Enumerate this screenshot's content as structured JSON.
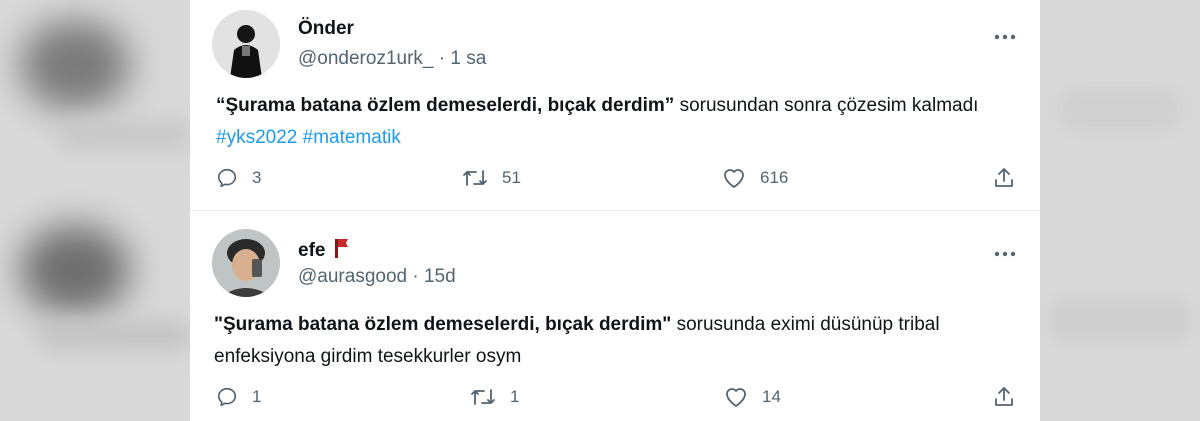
{
  "tweets": [
    {
      "display_name": "Önder",
      "handle": "@onderoz1urk_",
      "separator": "·",
      "time": "1 sa",
      "quote_bold": "“Şurama batana özlem demeselerdi, bıçak derdim”",
      "text_rest": " sorusundan sonra çözesim kalmadı ",
      "hashtags": [
        "#yks2022",
        "#matematik"
      ],
      "replies": "3",
      "retweets": "51",
      "likes": "616"
    },
    {
      "display_name": "efe",
      "handle": "@aurasgood",
      "separator": "·",
      "time": "15d",
      "quote_bold": "\"Şurama batana özlem demeselerdi, bıçak derdim\"",
      "text_rest": " sorusunda eximi düsünüp tribal enfeksiyona girdim tesekkurler osym",
      "replies": "1",
      "retweets": "1",
      "likes": "14"
    }
  ],
  "icons": {
    "reply": "reply-icon",
    "retweet": "retweet-icon",
    "like": "heart-icon",
    "share": "share-icon",
    "more": "more-options-icon",
    "flag": "red-flag-emoji"
  },
  "colors": {
    "hashtag": "#1d9bf0",
    "text": "#0f1419",
    "secondary": "#536471",
    "flag": "#c62a2a"
  }
}
